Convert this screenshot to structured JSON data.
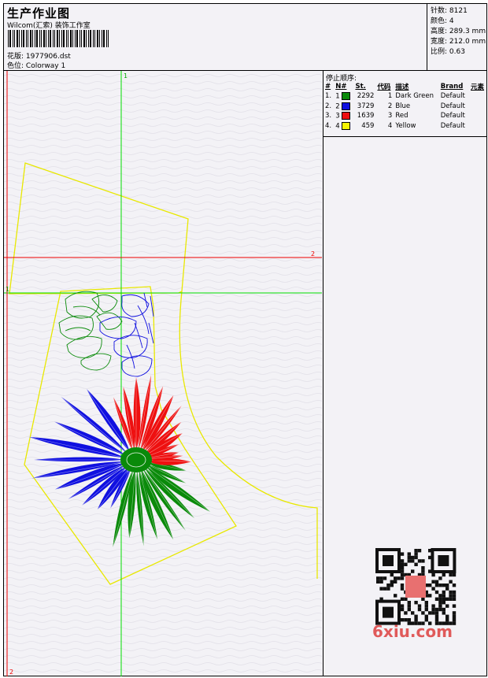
{
  "header": {
    "title": "生产作业图",
    "studio": "Wilcom(汇索) 装饰工作室",
    "design_label": "花版:",
    "design_value": "1977906.dst",
    "colorway_label": "色位:",
    "colorway_value": "Colorway 1"
  },
  "stats": [
    {
      "label": "针数:",
      "value": "8121"
    },
    {
      "label": "颜色:",
      "value": "4"
    },
    {
      "label": "高度:",
      "value": "289.3 mm"
    },
    {
      "label": "宽度:",
      "value": "212.0 mm"
    },
    {
      "label": "比例:",
      "value": "0.63"
    }
  ],
  "stop_sequence": {
    "title": "停止顺序:",
    "headers": [
      "#",
      "N#",
      "St.",
      "代码",
      "描述",
      "Brand",
      "元素"
    ],
    "rows": [
      {
        "idx": "1.",
        "n": "1",
        "stitches": "2292",
        "code": "1",
        "desc": "Dark Green",
        "brand": "Default",
        "color": "#0a8a0a"
      },
      {
        "idx": "2.",
        "n": "2",
        "stitches": "3729",
        "code": "2",
        "desc": "Blue",
        "brand": "Default",
        "color": "#1010e0"
      },
      {
        "idx": "3.",
        "n": "3",
        "stitches": "1639",
        "code": "3",
        "desc": "Red",
        "brand": "Default",
        "color": "#ee1010"
      },
      {
        "idx": "4.",
        "n": "4",
        "stitches": "459",
        "code": "4",
        "desc": "Yellow",
        "brand": "Default",
        "color": "#f5f500"
      }
    ]
  },
  "guides": {
    "green_top": "1",
    "green_left": "1",
    "red_right": "2",
    "red_bottom": "2"
  },
  "watermark": {
    "text": "6xiu.com"
  },
  "colors": {
    "green": "#0a8a0a",
    "blue": "#1010e0",
    "red": "#ee1010",
    "yellow": "#f0f000",
    "guide_green": "#00dd00",
    "guide_red": "#ee0000"
  }
}
